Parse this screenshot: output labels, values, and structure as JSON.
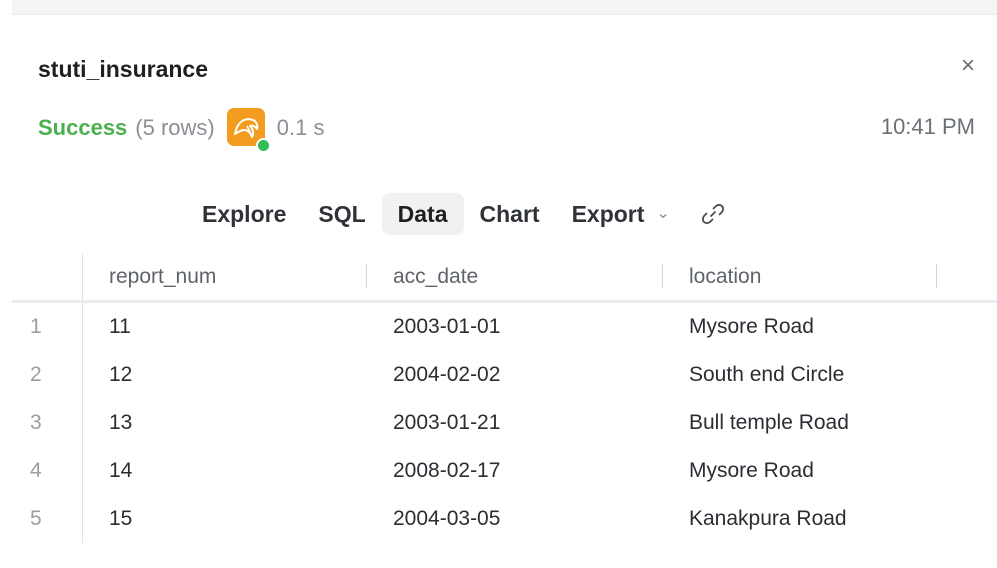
{
  "panel": {
    "title": "stuti_insurance",
    "close_symbol": "×",
    "status": {
      "label": "Success",
      "rows": "(5 rows)",
      "db_icon": "mysql-dolphin-icon",
      "db_icon_color": "#f39c1f",
      "connection_indicator_color": "#2fbf55",
      "duration": "0.1 s",
      "success_color": "#4caf50"
    },
    "timestamp": "10:41 PM"
  },
  "tabs": [
    {
      "label": "Explore",
      "active": false
    },
    {
      "label": "SQL",
      "active": false
    },
    {
      "label": "Data",
      "active": true
    },
    {
      "label": "Chart",
      "active": false
    },
    {
      "label": "Export",
      "active": false,
      "dropdown": true
    }
  ],
  "table": {
    "columns": [
      "report_num",
      "acc_date",
      "location"
    ],
    "rows": [
      {
        "index": "1",
        "report_num": "11",
        "acc_date": "2003-01-01",
        "location": "Mysore Road"
      },
      {
        "index": "2",
        "report_num": "12",
        "acc_date": "2004-02-02",
        "location": "South end Circle"
      },
      {
        "index": "3",
        "report_num": "13",
        "acc_date": "2003-01-21",
        "location": "Bull temple Road"
      },
      {
        "index": "4",
        "report_num": "14",
        "acc_date": "2008-02-17",
        "location": "Mysore Road"
      },
      {
        "index": "5",
        "report_num": "15",
        "acc_date": "2004-03-05",
        "location": "Kanakpura Road"
      }
    ]
  }
}
